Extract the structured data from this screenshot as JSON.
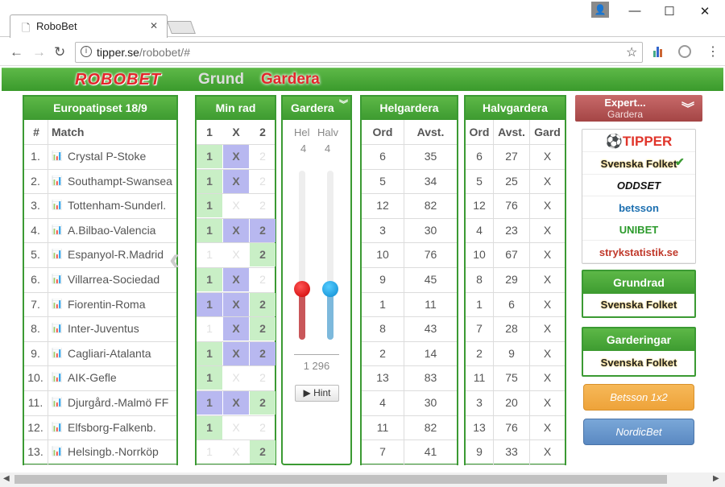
{
  "browser": {
    "tab_title": "RoboBet",
    "url_host": "tipper.se",
    "url_path": "/robobet/#",
    "minimize": "—",
    "maximize": "☐",
    "close": "✕"
  },
  "app": {
    "logo": "ROBOBET",
    "nav": [
      "Grund",
      "Gardera"
    ],
    "active_nav": "Gardera"
  },
  "coupon": {
    "title": "Europatipset 18/9",
    "col_num": "#",
    "col_match": "Match",
    "matches": [
      {
        "n": "1.",
        "name": "Crystal P-Stoke"
      },
      {
        "n": "2.",
        "name": "Southampt-Swansea"
      },
      {
        "n": "3.",
        "name": "Tottenham-Sunderl."
      },
      {
        "n": "4.",
        "name": "A.Bilbao-Valencia"
      },
      {
        "n": "5.",
        "name": "Espanyol-R.Madrid"
      },
      {
        "n": "6.",
        "name": "Villarrea-Sociedad"
      },
      {
        "n": "7.",
        "name": "Fiorentin-Roma"
      },
      {
        "n": "8.",
        "name": "Inter-Juventus"
      },
      {
        "n": "9.",
        "name": "Cagliari-Atalanta"
      },
      {
        "n": "10.",
        "name": "AIK-Gefle"
      },
      {
        "n": "11.",
        "name": "Djurgård.-Malmö FF"
      },
      {
        "n": "12.",
        "name": "Elfsborg-Falkenb."
      },
      {
        "n": "13.",
        "name": "Helsingb.-Norrköp"
      }
    ]
  },
  "minrad": {
    "title": "Min rad",
    "cols": [
      "1",
      "X",
      "2"
    ],
    "rows": [
      [
        "g",
        "p",
        ""
      ],
      [
        "g",
        "p",
        ""
      ],
      [
        "g",
        "",
        ""
      ],
      [
        "g",
        "p",
        "p"
      ],
      [
        "",
        "",
        "g"
      ],
      [
        "g",
        "p",
        ""
      ],
      [
        "p",
        "p",
        "g"
      ],
      [
        "",
        "p",
        "g"
      ],
      [
        "g",
        "p",
        "p"
      ],
      [
        "g",
        "",
        ""
      ],
      [
        "p",
        "p",
        "g"
      ],
      [
        "g",
        "",
        ""
      ],
      [
        "",
        "",
        "g"
      ]
    ]
  },
  "gardera": {
    "title": "Gardera",
    "col_hel": "Hel",
    "col_halv": "Halv",
    "hel_value": "4",
    "halv_value": "4",
    "hel_level": 0.3,
    "halv_level": 0.3,
    "total": "1 296",
    "hint_label": "▶ Hint"
  },
  "helgardera": {
    "title": "Helgardera",
    "cols": [
      "Ord",
      "Avst."
    ],
    "rows": [
      [
        "6",
        "35"
      ],
      [
        "5",
        "34"
      ],
      [
        "12",
        "82"
      ],
      [
        "3",
        "30"
      ],
      [
        "10",
        "76"
      ],
      [
        "9",
        "45"
      ],
      [
        "1",
        "11"
      ],
      [
        "8",
        "43"
      ],
      [
        "2",
        "14"
      ],
      [
        "13",
        "83"
      ],
      [
        "4",
        "30"
      ],
      [
        "11",
        "82"
      ],
      [
        "7",
        "41"
      ]
    ]
  },
  "halvgardera": {
    "title": "Halvgardera",
    "cols": [
      "Ord",
      "Avst.",
      "Gard"
    ],
    "rows": [
      [
        "6",
        "27",
        "X"
      ],
      [
        "5",
        "25",
        "X"
      ],
      [
        "12",
        "76",
        "X"
      ],
      [
        "4",
        "23",
        "X"
      ],
      [
        "10",
        "67",
        "X"
      ],
      [
        "8",
        "29",
        "X"
      ],
      [
        "1",
        "6",
        "X"
      ],
      [
        "7",
        "28",
        "X"
      ],
      [
        "2",
        "9",
        "X"
      ],
      [
        "11",
        "75",
        "X"
      ],
      [
        "3",
        "20",
        "X"
      ],
      [
        "13",
        "76",
        "X"
      ],
      [
        "9",
        "33",
        "X"
      ]
    ]
  },
  "sidebar": {
    "expert_title": "Expert...",
    "expert_sub": "Gardera",
    "sources": [
      {
        "name": "⚽TIPPER",
        "color": "#e0352b"
      },
      {
        "name": "Svenska Folket",
        "color": "#222"
      },
      {
        "name": "ODDSET",
        "color": "#111"
      },
      {
        "name": "betsson",
        "color": "#1c6fb0"
      },
      {
        "name": "UNIBET",
        "color": "#2b9a2b"
      },
      {
        "name": "strykstatistik.se",
        "color": "#c0392b"
      }
    ],
    "selected_check": "✔",
    "grundrad_title": "Grundrad",
    "grundrad_source": "Svenska Folket",
    "garderingar_title": "Garderingar",
    "garderingar_source": "Svenska Folket",
    "betsson_button": "Betsson 1x2",
    "nordicbet_button": "NordicBet"
  }
}
